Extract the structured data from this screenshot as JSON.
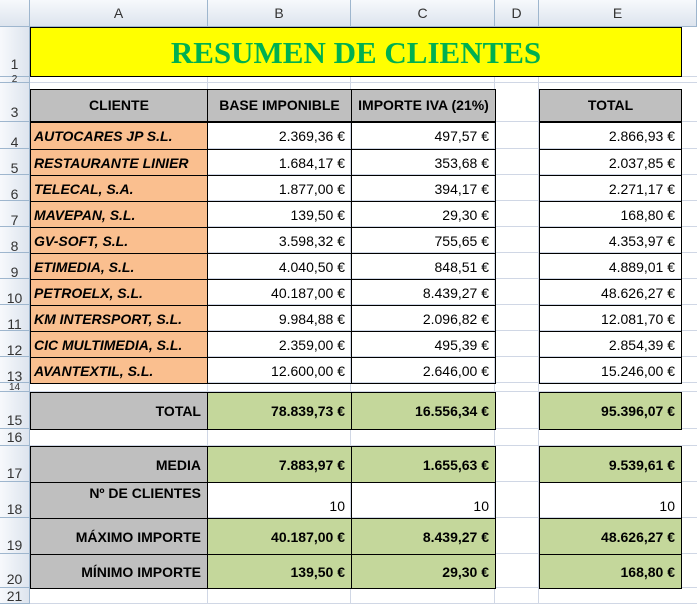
{
  "columns": [
    "A",
    "B",
    "C",
    "D",
    "E"
  ],
  "rows": [
    "1",
    "2",
    "3",
    "4",
    "5",
    "6",
    "7",
    "8",
    "9",
    "10",
    "11",
    "12",
    "13",
    "14",
    "15",
    "16",
    "17",
    "18",
    "19",
    "20",
    "21"
  ],
  "title": "RESUMEN DE CLIENTES",
  "headers": {
    "cliente": "CLIENTE",
    "base": "BASE IMPONIBLE",
    "iva": "IMPORTE IVA (21%)",
    "total": "TOTAL"
  },
  "clients": [
    {
      "name": "AUTOCARES JP S.L.",
      "base": "2.369,36 €",
      "iva": "497,57 €",
      "total": "2.866,93 €"
    },
    {
      "name": "RESTAURANTE LINIER",
      "base": "1.684,17 €",
      "iva": "353,68 €",
      "total": "2.037,85 €"
    },
    {
      "name": "TELECAL, S.A.",
      "base": "1.877,00 €",
      "iva": "394,17 €",
      "total": "2.271,17 €"
    },
    {
      "name": "MAVEPAN, S.L.",
      "base": "139,50 €",
      "iva": "29,30 €",
      "total": "168,80 €"
    },
    {
      "name": "GV-SOFT, S.L.",
      "base": "3.598,32 €",
      "iva": "755,65 €",
      "total": "4.353,97 €"
    },
    {
      "name": "ETIMEDIA, S.L.",
      "base": "4.040,50 €",
      "iva": "848,51 €",
      "total": "4.889,01 €"
    },
    {
      "name": "PETROELX, S.L.",
      "base": "40.187,00 €",
      "iva": "8.439,27 €",
      "total": "48.626,27 €"
    },
    {
      "name": "KM INTERSPORT, S.L.",
      "base": "9.984,88 €",
      "iva": "2.096,82 €",
      "total": "12.081,70 €"
    },
    {
      "name": "CIC MULTIMEDIA, S.L.",
      "base": "2.359,00 €",
      "iva": "495,39 €",
      "total": "2.854,39 €"
    },
    {
      "name": "AVANTEXTIL, S.L.",
      "base": "12.600,00 €",
      "iva": "2.646,00 €",
      "total": "15.246,00 €"
    }
  ],
  "summary": [
    {
      "label": "TOTAL",
      "base": "78.839,73 €",
      "iva": "16.556,34 €",
      "total": "95.396,07 €"
    },
    {
      "label": "MEDIA",
      "base": "7.883,97 €",
      "iva": "1.655,63 €",
      "total": "9.539,61 €"
    },
    {
      "label": "Nº DE CLIENTES",
      "base": "10",
      "iva": "10",
      "total": "10"
    },
    {
      "label": "MÁXIMO IMPORTE",
      "base": "40.187,00 €",
      "iva": "8.439,27 €",
      "total": "48.626,27 €"
    },
    {
      "label": "MÍNIMO IMPORTE",
      "base": "139,50 €",
      "iva": "29,30 €",
      "total": "168,80 €"
    }
  ]
}
